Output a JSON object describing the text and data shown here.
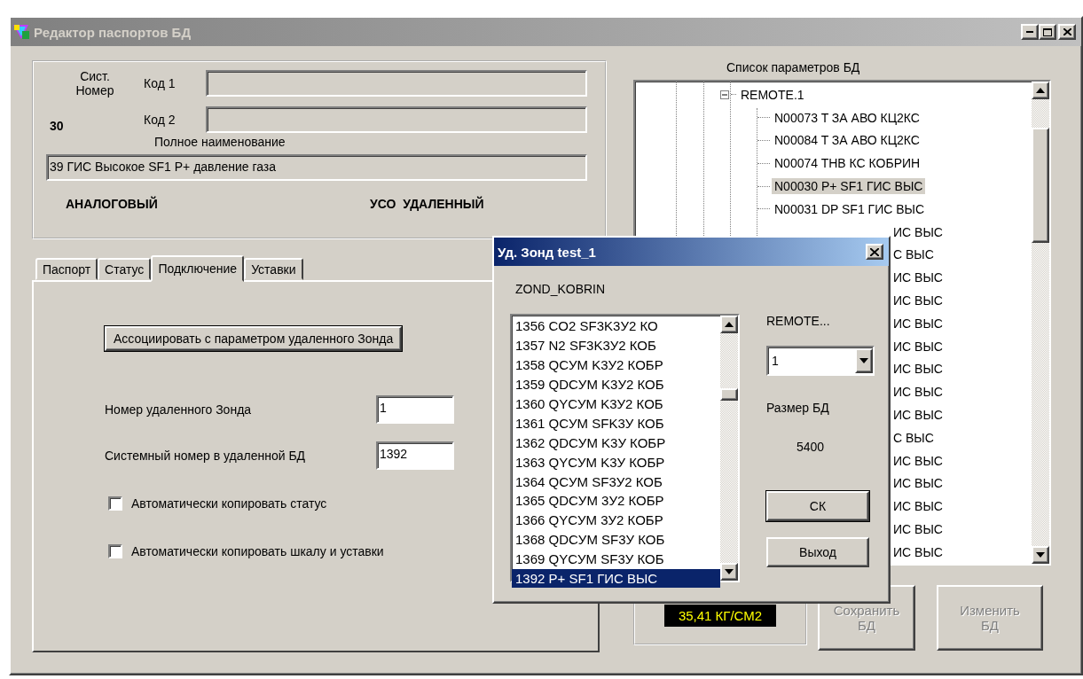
{
  "window": {
    "title": "Редактор паспортов БД",
    "active": false
  },
  "header": {
    "sys_label": "Сист.\nНомер",
    "sys_number": "30",
    "code1_label": "Код 1",
    "code2_label": "Код 2",
    "full_name_label": "Полное наименование",
    "full_name": "39 ГИС Высокое SF1 P+ давление газа",
    "type_label": "АНАЛОГОВЫЙ",
    "uso_label": "УСО  УДАЛЕННЫЙ"
  },
  "tabs": [
    {
      "label": "Паспорт",
      "selected": false
    },
    {
      "label": "Статус",
      "selected": false
    },
    {
      "label": "Подключение",
      "selected": true
    },
    {
      "label": "Уставки",
      "selected": false
    }
  ],
  "connection": {
    "associate_button": "Ассоциировать с параметром удаленного Зонда",
    "probe_label": "Номер удаленного Зонда",
    "probe_value": "1",
    "sysnum_label": "Системный номер в удаленной БД",
    "sysnum_value": "1392",
    "checkboxes": [
      {
        "label": "Автоматически копировать статус",
        "checked": false
      },
      {
        "label": "Автоматически копировать шкалу и уставки",
        "checked": false
      }
    ]
  },
  "tree": {
    "title": "Список параметров БД",
    "node": {
      "label": "REMOTE.1",
      "expanded": true,
      "children": [
        {
          "label": "N00073 T ЗА АВО КЦ2КС",
          "selected": false,
          "kind": "full"
        },
        {
          "label": "N00084 T ЗА АВО КЦ2КС",
          "selected": false,
          "kind": "full"
        },
        {
          "label": "N00074 THB КС КОБРИН",
          "selected": false,
          "kind": "full"
        },
        {
          "label": "N00030 P+ SF1 ГИС ВЫС",
          "selected": true,
          "kind": "full"
        },
        {
          "label": "N00031 DP SF1 ГИС ВЫС",
          "selected": false,
          "kind": "full"
        },
        {
          "label": "ИС ВЫС",
          "selected": false,
          "kind": "covered"
        },
        {
          "label": "С ВЫС",
          "selected": false,
          "kind": "covered"
        },
        {
          "label": "ИС ВЫС",
          "selected": false,
          "kind": "covered"
        },
        {
          "label": "ИС ВЫС",
          "selected": false,
          "kind": "covered"
        },
        {
          "label": "ИС ВЫС",
          "selected": false,
          "kind": "covered"
        },
        {
          "label": "ИС ВЫС",
          "selected": false,
          "kind": "covered"
        },
        {
          "label": "ИС ВЫС",
          "selected": false,
          "kind": "covered"
        },
        {
          "label": "ИС ВЫС",
          "selected": false,
          "kind": "covered"
        },
        {
          "label": "ИС ВЫС",
          "selected": false,
          "kind": "covered"
        },
        {
          "label": "С ВЫС",
          "selected": false,
          "kind": "covered"
        },
        {
          "label": "ИС ВЫС",
          "selected": false,
          "kind": "covered"
        },
        {
          "label": "ИС ВЫС",
          "selected": false,
          "kind": "covered"
        },
        {
          "label": "ИС ВЫС",
          "selected": false,
          "kind": "covered"
        },
        {
          "label": "ИС ВЫС",
          "selected": false,
          "kind": "covered"
        },
        {
          "label": "ИС ВЫС",
          "selected": false,
          "kind": "covered"
        }
      ]
    }
  },
  "readout": "35,41 КГ/СМ2",
  "buttons": [
    {
      "label": "Сохранить\nБД",
      "disabled": true
    },
    {
      "label": "Изменить\nБД",
      "disabled": true
    }
  ],
  "dialog": {
    "title": "Уд. Зонд test_1",
    "active": true,
    "probe_name": "ZOND_KOBRIN",
    "items": [
      {
        "label": "1356 CO2 SF3K3У2 КО",
        "selected": false
      },
      {
        "label": "1357 N2 SF3K3У2 КОБ",
        "selected": false
      },
      {
        "label": "1358 QCУM K3У2 КОБР",
        "selected": false
      },
      {
        "label": "1359 QDCУM K3У2 КОБ",
        "selected": false
      },
      {
        "label": "1360 QYCУM K3У2 КОБ",
        "selected": false
      },
      {
        "label": "1361 QCУM SFK3У КОБ",
        "selected": false
      },
      {
        "label": "1362 QDCУM K3У КОБР",
        "selected": false
      },
      {
        "label": "1363 QYCУM K3У КОБР",
        "selected": false
      },
      {
        "label": "1364 QCУM SF3У2 КОБ",
        "selected": false
      },
      {
        "label": "1365 QDCУM 3У2 КОБР",
        "selected": false
      },
      {
        "label": "1366 QYCУM 3У2 КОБР",
        "selected": false
      },
      {
        "label": "1368 QDCУM SF3У КОБ",
        "selected": false
      },
      {
        "label": "1369 QYCУM SF3У КОБ",
        "selected": false
      },
      {
        "label": "1392 P+ SF1 ГИС ВЫС",
        "selected": true
      }
    ],
    "remote_label": "REMOTE...",
    "remote_value": "1",
    "size_label": "Размер БД",
    "size_value": "5400",
    "ok_button": "СК",
    "exit_button": "Выход"
  }
}
